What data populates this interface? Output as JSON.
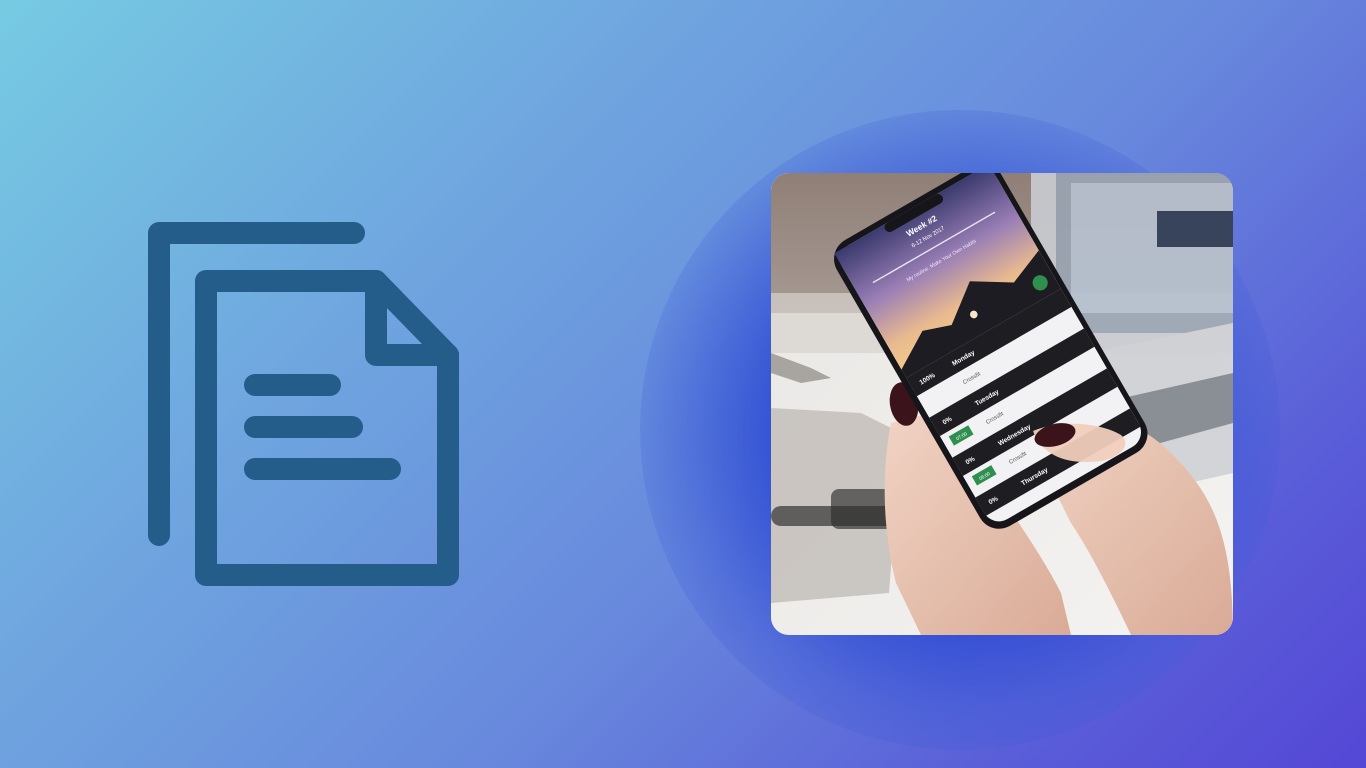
{
  "colors": {
    "background_start": "#76cbe2",
    "background_end": "#5447d6",
    "glow": "#1f3acb",
    "document_icon": "#245c8a"
  },
  "icons": {
    "document_icon": "copy-documents-icon"
  },
  "photo": {
    "description_icon": "phone-photo",
    "app_screen": {
      "week_title": "Week #2",
      "week_dates": "6-12 Nov 2017",
      "quote": "My routine. Make Your Own Habits",
      "rows": [
        {
          "percent": "100%",
          "day": "Monday",
          "habit": "Crossfit"
        },
        {
          "percent": "0%",
          "day": "Tuesday",
          "habit": "Crossfit",
          "badge": "07:00"
        },
        {
          "percent": "0%",
          "day": "Wednesday",
          "habit": "Crossfit",
          "badge": "06:00"
        },
        {
          "percent": "0%",
          "day": "Thursday"
        }
      ]
    }
  }
}
